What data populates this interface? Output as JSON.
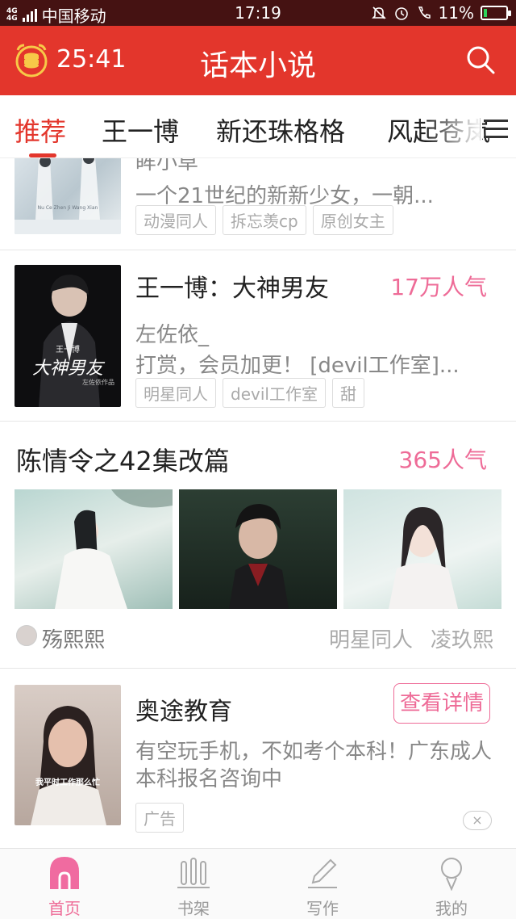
{
  "status_bar": {
    "network_type": "4G 4G",
    "carrier": "中国移动",
    "time": "17:19",
    "battery": "11%",
    "icons": [
      "mute-icon",
      "alarm-icon",
      "wifi-call-icon",
      "battery-icon"
    ]
  },
  "header": {
    "timer": "25:41",
    "title": "话本小说",
    "icons": [
      "alarm-clock-coin-icon",
      "search-icon"
    ],
    "accent_color": "#e3362c"
  },
  "tabs": [
    {
      "label": "推荐",
      "active": true
    },
    {
      "label": "王一博",
      "active": false
    },
    {
      "label": "新还珠格格",
      "active": false
    },
    {
      "label": "风起苍岚",
      "active": false
    }
  ],
  "books": [
    {
      "author": "眸小草",
      "description": "一个21世纪的新新少女，一朝...",
      "tags": [
        "动漫同人",
        "拆忘羡cp",
        "原创女主"
      ],
      "cover_caption": "Nu Ce Zhen Ji Wang Xian"
    },
    {
      "title": "王一博：大神男友",
      "popularity": "17万人气",
      "author": "左佐依_",
      "description": "打赏，会员加更！ [devil工作室]...",
      "tags": [
        "明星同人",
        "devil工作室",
        "甜"
      ],
      "cover_caption": {
        "top": "王一博",
        "main": "大神男友",
        "sub": "左佐依作品"
      }
    }
  ],
  "topic": {
    "title": "陈情令之42集改篇",
    "popularity": "365人气",
    "author": "殇熙熙",
    "tags": [
      "明星同人",
      "凌玖熙"
    ]
  },
  "ad": {
    "title": "奥途教育",
    "button": "查看详情",
    "description": "有空玩手机，不如考个本科！广东成人本科报名咨询中",
    "badge": "广告",
    "close": "×",
    "image_caption": "我平时工作那么忙"
  },
  "bottom_nav": [
    {
      "label": "首页",
      "icon": "home-icon",
      "active": true
    },
    {
      "label": "书架",
      "icon": "bookshelf-icon",
      "active": false
    },
    {
      "label": "写作",
      "icon": "pencil-icon",
      "active": false
    },
    {
      "label": "我的",
      "icon": "profile-icon",
      "active": false
    }
  ],
  "colors": {
    "status_bar": "#451212",
    "accent_red": "#e3362c",
    "accent_pink": "#ee6b97"
  }
}
